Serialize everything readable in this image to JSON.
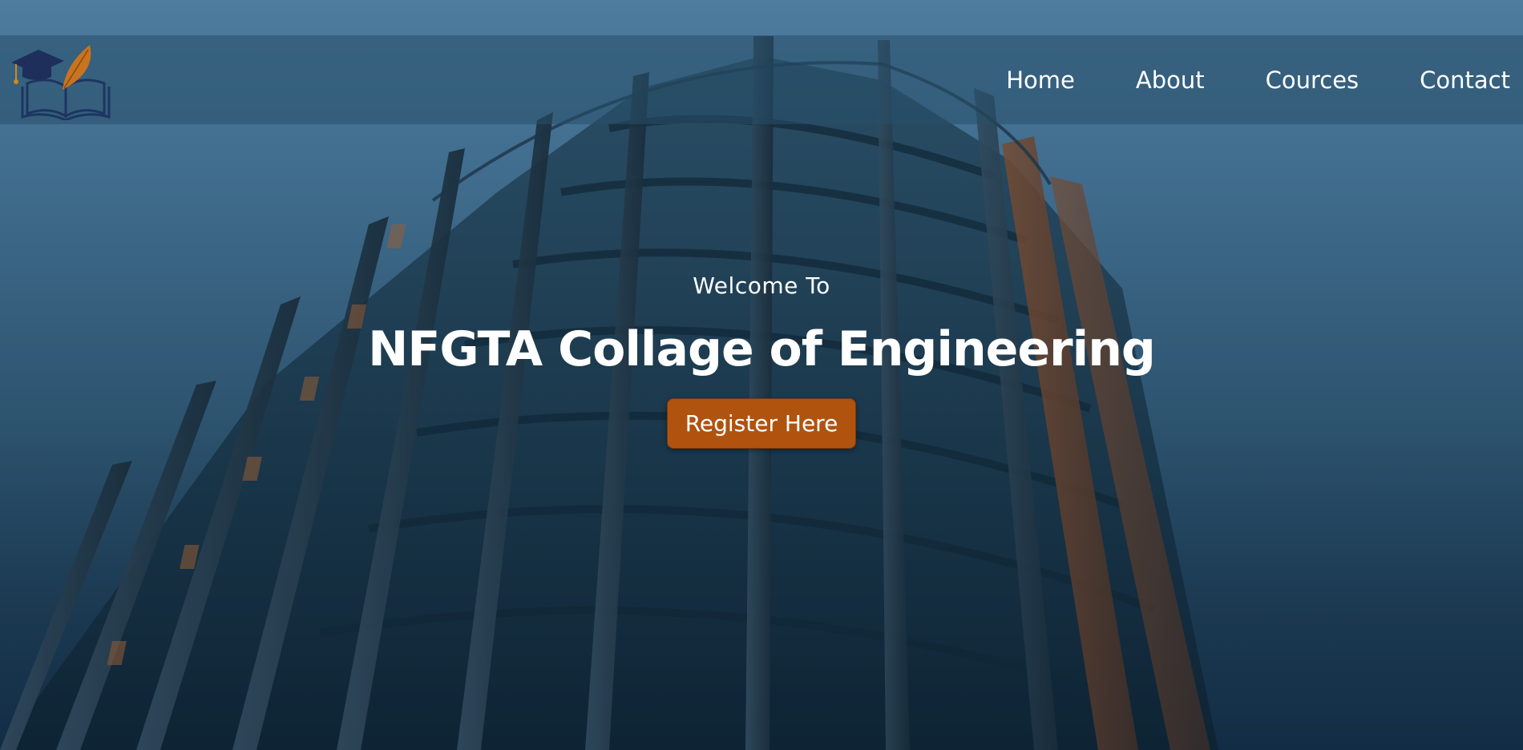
{
  "nav": {
    "links": [
      "Home",
      "About",
      "Cources",
      "Contact"
    ]
  },
  "hero": {
    "welcome": "Welcome To",
    "title": "NFGTA Collage of Engineering",
    "button_label": "Register Here"
  },
  "icons": {
    "logo": "graduation-cap-book-quill-logo"
  },
  "colors": {
    "accent": "#b0530f",
    "navbar_overlay": "#285069",
    "sky": "#5a8db3"
  }
}
